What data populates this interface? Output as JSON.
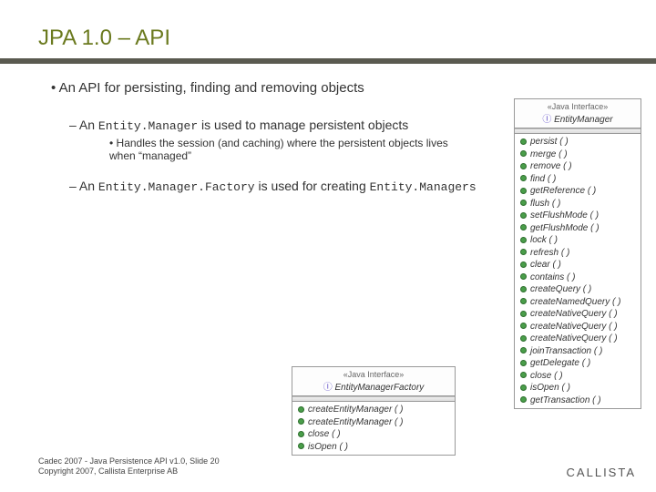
{
  "title": "JPA 1.0 – API",
  "main_bullet": "An API for persisting, finding and removing objects",
  "sub1_pre": "An ",
  "sub1_code": "Entity.Manager",
  "sub1_post": " is used to manage persistent objects",
  "sub1_child": "Handles the session (and caching) where the persistent objects lives when “managed”",
  "sub2_pre": "An ",
  "sub2_code": "Entity.Manager.Factory",
  "sub2_mid": " is used for creating ",
  "sub2_code2": "Entity.Managers",
  "uml_em": {
    "stereo": "«Java Interface»",
    "name": "EntityManager",
    "ops": [
      "persist ( )",
      "merge ( )",
      "remove ( )",
      "find ( )",
      "getReference ( )",
      "flush ( )",
      "setFlushMode ( )",
      "getFlushMode ( )",
      "lock ( )",
      "refresh ( )",
      "clear ( )",
      "contains ( )",
      "createQuery ( )",
      "createNamedQuery ( )",
      "createNativeQuery ( )",
      "createNativeQuery ( )",
      "createNativeQuery ( )",
      "joinTransaction ( )",
      "getDelegate ( )",
      "close ( )",
      "isOpen ( )",
      "getTransaction ( )"
    ]
  },
  "uml_emf": {
    "stereo": "«Java Interface»",
    "name": "EntityManagerFactory",
    "ops": [
      "createEntityManager ( )",
      "createEntityManager ( )",
      "close ( )",
      "isOpen ( )"
    ]
  },
  "footer_l1": "Cadec 2007 - Java Persistence API v1.0, Slide 20",
  "footer_l2": "Copyright 2007, Callista Enterprise AB",
  "brand": "CALLISTA"
}
